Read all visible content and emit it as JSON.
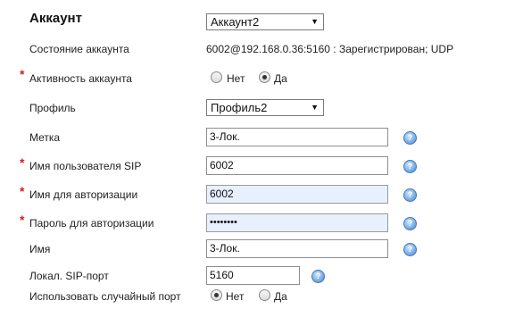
{
  "title": "Аккаунт",
  "account_select": {
    "value": "Аккаунт2"
  },
  "rows": {
    "status": {
      "label": "Состояние аккаунта",
      "value": "6002@192.168.0.36:5160 : Зарегистрирован; UDP"
    },
    "active": {
      "label": "Активность аккаунта",
      "options": [
        "Нет",
        "Да"
      ],
      "selected": "Да"
    },
    "profile": {
      "label": "Профиль",
      "value": "Профиль2"
    },
    "tag": {
      "label": "Метка",
      "value": "3-Лок."
    },
    "sip_user": {
      "label": "Имя пользователя SIP",
      "value": "6002"
    },
    "auth_name": {
      "label": "Имя для авторизации",
      "value": "6002"
    },
    "auth_password": {
      "label": "Пароль для авторизации",
      "value": "••••••••"
    },
    "name": {
      "label": "Имя",
      "value": "3-Лок."
    },
    "local_port": {
      "label": "Локал. SIP-порт",
      "value": "5160"
    },
    "random_port": {
      "label": "Использовать случайный порт",
      "options": [
        "Нет",
        "Да"
      ],
      "selected": "Нет"
    }
  },
  "required_mark": "*",
  "help_glyph": "?",
  "dropdown_arrow": "▼"
}
